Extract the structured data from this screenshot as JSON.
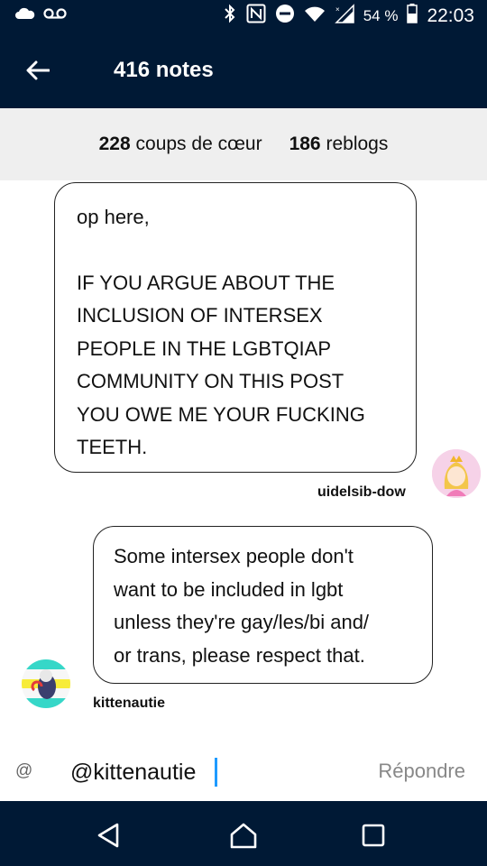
{
  "status_bar": {
    "battery_percent": "54 %",
    "time": "22:03",
    "icons": [
      "cloud-icon",
      "voicemail-icon",
      "bluetooth-icon",
      "nfc-icon",
      "dnd-icon",
      "wifi-icon",
      "signal-icon",
      "battery-icon"
    ]
  },
  "header": {
    "title": "416 notes",
    "back_icon": "arrow-left-icon"
  },
  "counts": {
    "likes_number": "228",
    "likes_label": "coups de cœur",
    "reblogs_number": "186",
    "reblogs_label": "reblogs"
  },
  "notes": [
    {
      "username": "uidelsib-dow",
      "lines": [
        "op here,",
        "IF YOU ARGUE ABOUT THE",
        "INCLUSION OF INTERSEX",
        "PEOPLE IN THE LGBTQIAP",
        "COMMUNITY ON THIS POST",
        "YOU OWE ME YOUR FUCKING",
        "TEETH."
      ]
    },
    {
      "username": "kittenautie",
      "lines": [
        "Some intersex people don't",
        "want to be included in lgbt",
        "unless they're gay/les/bi and/",
        "or trans, please respect that."
      ]
    }
  ],
  "compose": {
    "at_symbol": "@",
    "value": "@kittenautie",
    "reply_label": "Répondre"
  },
  "colors": {
    "nav_dark": "#001935",
    "counts_bg": "#efefef",
    "caret_blue": "#1e9bff"
  }
}
